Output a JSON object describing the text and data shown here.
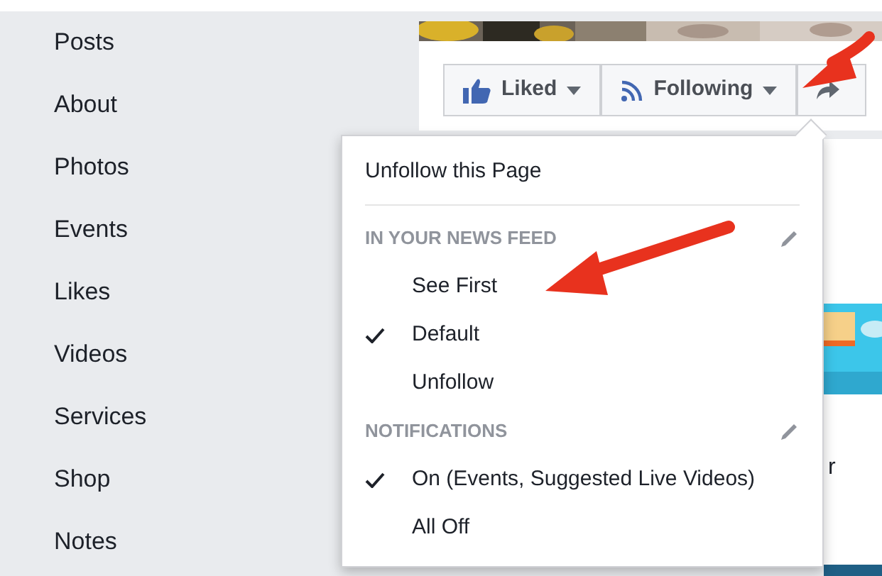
{
  "sidebar": {
    "items": [
      {
        "label": "Posts"
      },
      {
        "label": "About"
      },
      {
        "label": "Photos"
      },
      {
        "label": "Events"
      },
      {
        "label": "Likes"
      },
      {
        "label": "Videos"
      },
      {
        "label": "Services"
      },
      {
        "label": "Shop"
      },
      {
        "label": "Notes"
      }
    ]
  },
  "actions": [
    {
      "kind": "like",
      "label": "Liked"
    },
    {
      "kind": "follow",
      "label": "Following"
    },
    {
      "kind": "share"
    }
  ],
  "menu": {
    "items": [
      {
        "kind": "action",
        "label": "Unfollow this Page"
      },
      {
        "kind": "header",
        "label": "IN YOUR NEWS FEED"
      },
      {
        "kind": "option",
        "label": "See First",
        "checked": false
      },
      {
        "kind": "option",
        "label": "Default",
        "checked": true
      },
      {
        "kind": "option",
        "label": "Unfollow",
        "checked": false
      },
      {
        "kind": "header",
        "label": "NOTIFICATIONS"
      },
      {
        "kind": "option",
        "label": "On (Events, Suggested Live Videos)",
        "checked": true
      },
      {
        "kind": "option",
        "label": "All Off",
        "checked": false
      }
    ]
  },
  "behind_text": "r"
}
